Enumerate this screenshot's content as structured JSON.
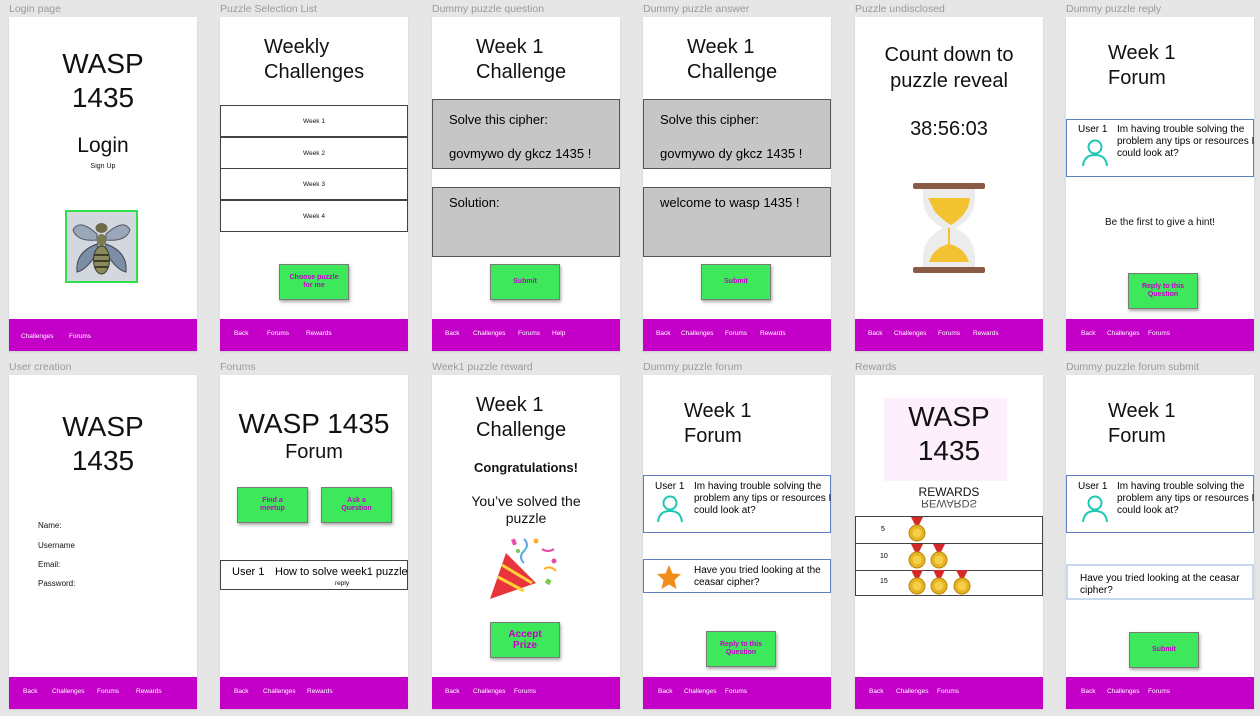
{
  "frames": {
    "login": {
      "label": "Login page",
      "title_line1": "WASP",
      "title_line2": "1435",
      "heading": "Login",
      "signup": "Sign Up",
      "nav": [
        "Challenges",
        "Forums"
      ]
    },
    "puzzle_list": {
      "label": "Puzzle Selection List",
      "title_line1": "Weekly",
      "title_line2": "Challenges",
      "weeks": [
        "Week 1",
        "Week 2",
        "Week 3",
        "Week 4"
      ],
      "choose_button_line1": "Choose puzzle",
      "choose_button_line2": "for me",
      "nav": [
        "Back",
        "Forums",
        "Rewards"
      ]
    },
    "puzzle_question": {
      "label": "Dummy puzzle question",
      "title_line1": "Week 1",
      "title_line2": "Challenge",
      "prompt": "Solve this cipher:",
      "cipher": "govmywo dy gkcz 1435 !",
      "solution_label": "Solution:",
      "submit": "Submit",
      "nav": [
        "Back",
        "Challenges",
        "Forums",
        "Help"
      ]
    },
    "puzzle_answer": {
      "label": "Dummy puzzle answer",
      "title_line1": "Week 1",
      "title_line2": "Challenge",
      "prompt": "Solve this cipher:",
      "cipher": "govmywo dy gkcz 1435 !",
      "answer": "welcome to wasp 1435 !",
      "submit": "Submit",
      "nav": [
        "Back",
        "Challenges",
        "Forums",
        "Rewards"
      ]
    },
    "undisclosed": {
      "label": "Puzzle undisclosed",
      "title_line1": "Count down to",
      "title_line2": "puzzle reveal",
      "timer": "38:56:03",
      "nav": [
        "Back",
        "Challenges",
        "Forums",
        "Rewards"
      ]
    },
    "puzzle_reply": {
      "label": "Dummy puzzle reply",
      "title_line1": "Week 1",
      "title_line2": "Forum",
      "user": "User 1",
      "message": "Im having trouble solving the problem any tips or resources I could look at?",
      "empty": "Be the first to give a hint!",
      "reply_line1": "Reply to this",
      "reply_line2": "Question",
      "nav": [
        "Back",
        "Challenges",
        "Forums"
      ]
    },
    "user_creation": {
      "label": "User creation",
      "title_line1": "WASP",
      "title_line2": "1435",
      "fields": [
        "Name:",
        "Username",
        "Email:",
        "Password:"
      ],
      "nav": [
        "Back",
        "Challenges",
        "Forums",
        "Rewards"
      ]
    },
    "forums": {
      "label": "Forums",
      "title": "WASP 1435",
      "subtitle": "Forum",
      "meetup_line1": "Find a",
      "meetup_line2": "meetup",
      "ask_line1": "Ask a",
      "ask_line2": "Question",
      "post_user": "User 1",
      "post_text": "How to solve week1 puzzle",
      "post_reply": "reply",
      "nav": [
        "Back",
        "Challenges",
        "Rewards"
      ]
    },
    "reward": {
      "label": "Week1 puzzle reward",
      "title_line1": "Week 1",
      "title_line2": "Challenge",
      "congrats": "Congratulations!",
      "solved_line1": "You’ve solved the",
      "solved_line2": "puzzle",
      "accept_line1": "Accept",
      "accept_line2": "Prize",
      "nav": [
        "Back",
        "Challenges",
        "Forums"
      ]
    },
    "puzzle_forum": {
      "label": "Dummy puzzle forum",
      "title_line1": "Week 1",
      "title_line2": "Forum",
      "user": "User 1",
      "message": "Im having trouble solving the problem any tips or resources I could look at?",
      "reply": "Have you tried looking at the ceasar cipher?",
      "reply_line1": "Reply to this",
      "reply_line2": "Question",
      "nav": [
        "Back",
        "Challenges",
        "Forums"
      ]
    },
    "rewards": {
      "label": "Rewards",
      "title_line1": "WASP",
      "title_line2": "1435",
      "rewards_title": "REWARDS",
      "rewards_mirror": "REWARDS",
      "rows": [
        {
          "count": "5",
          "medals": 1
        },
        {
          "count": "10",
          "medals": 2
        },
        {
          "count": "15",
          "medals": 3
        }
      ],
      "nav": [
        "Back",
        "Challenges",
        "Forums"
      ]
    },
    "forum_submit": {
      "label": "Dummy puzzle forum submit",
      "title_line1": "Week 1",
      "title_line2": "Forum",
      "user": "User 1",
      "message": "Im having trouble solving the problem any tips or resources I could look at?",
      "input_text": "Have you tried looking at the ceasar cipher?",
      "submit": "Submit",
      "nav": [
        "Back",
        "Challenges",
        "Forums"
      ]
    }
  },
  "colors": {
    "nav": "#c400c8",
    "button": "#3de85a",
    "button_text": "#c400c8",
    "gray_box": "#c6c6c6",
    "avatar": "#1fc7b4"
  },
  "icons": [
    "wasp-icon",
    "hourglass-icon",
    "user-avatar-icon",
    "party-popper-icon",
    "star-icon",
    "medal-icon"
  ]
}
